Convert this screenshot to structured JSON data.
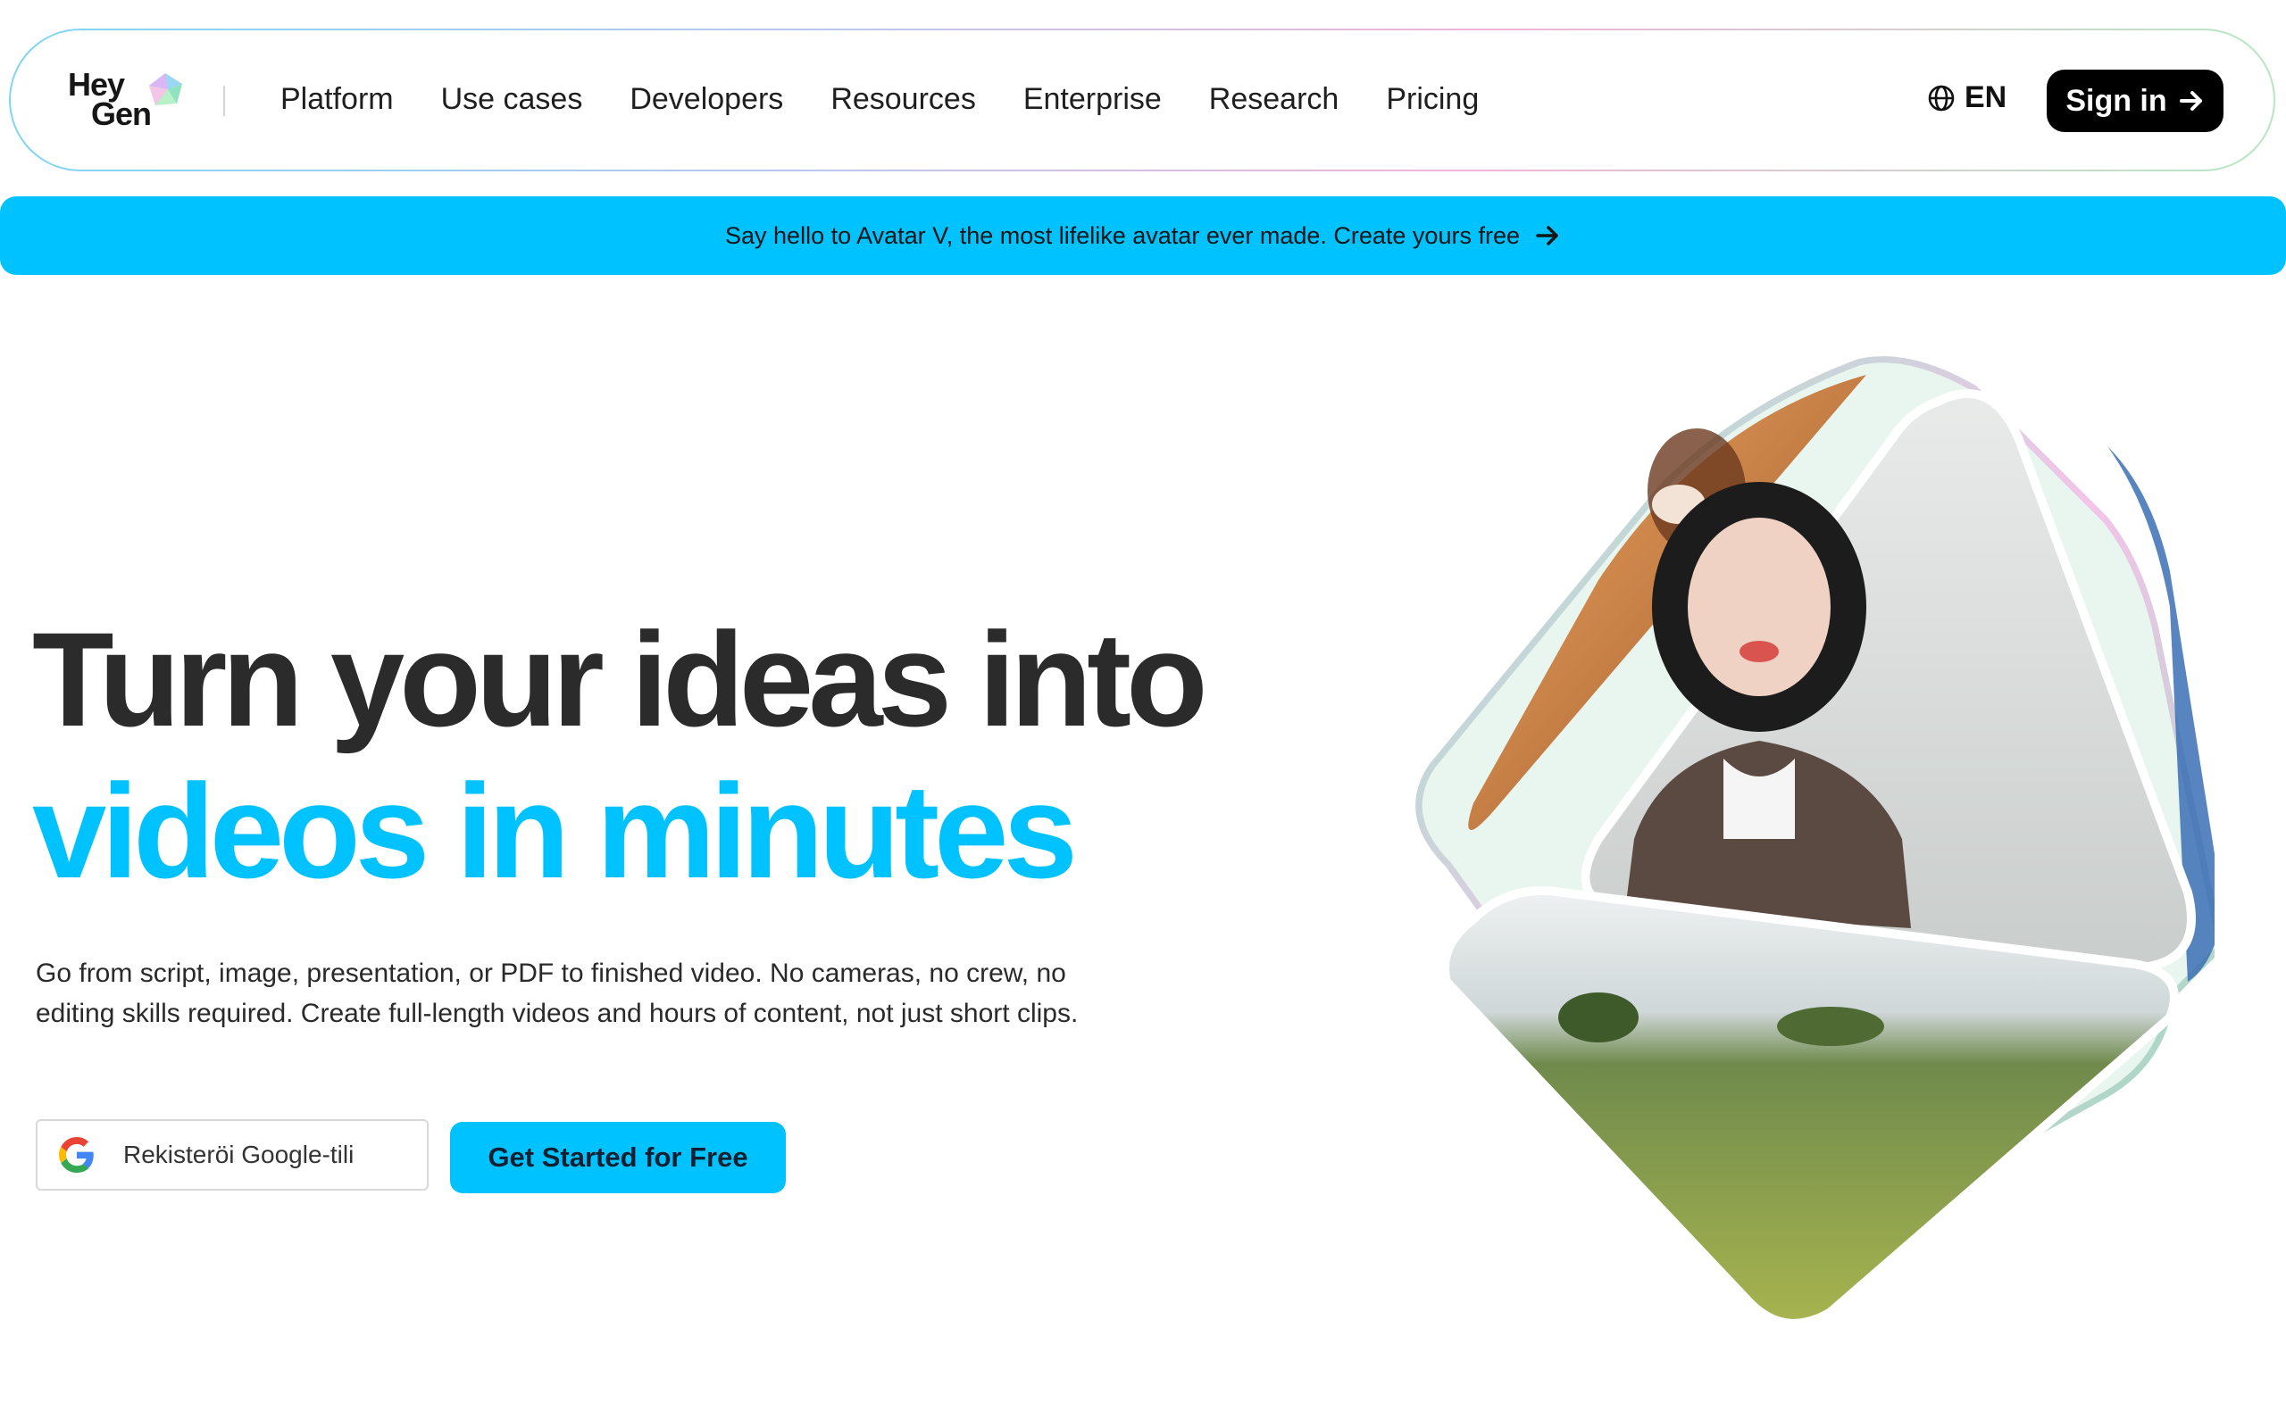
{
  "nav": {
    "logo_line1": "Hey",
    "logo_line2": "Gen",
    "links": [
      "Platform",
      "Use cases",
      "Developers",
      "Resources",
      "Enterprise",
      "Research",
      "Pricing"
    ],
    "language": "EN",
    "signin_label": "Sign in",
    "icons": {
      "language": "globe-icon",
      "signin": "arrow-right-icon"
    }
  },
  "banner": {
    "text": "Say hello to Avatar V, the most lifelike avatar ever made. Create yours free",
    "color": "#00c2ff",
    "icon": "arrow-right-icon"
  },
  "hero": {
    "title_line1": "Turn your ideas into",
    "title_line2": "videos in minutes",
    "description": "Go from script, image, presentation, or PDF to finished video. No cameras, no crew, no editing skills required. Create full-length videos and hours of content, not just short clips.",
    "google_button_label": "Rekisteröi Google-tili",
    "cta_label": "Get Started for Free",
    "accent_color": "#00c2ff",
    "icons": {
      "google": "google-icon"
    }
  }
}
